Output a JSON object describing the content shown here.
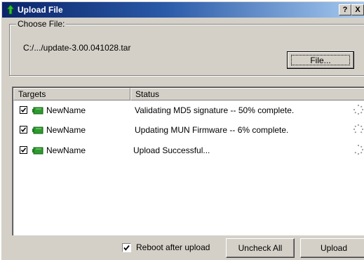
{
  "window": {
    "title": "Upload File",
    "help_label": "?",
    "close_label": "X"
  },
  "choose_file": {
    "legend": "Choose File:",
    "path": "C:/.../update-3.00.041028.tar",
    "file_button_label": "File..."
  },
  "list": {
    "columns": [
      "Targets",
      "Status"
    ],
    "rows": [
      {
        "checked": true,
        "target": "NewName",
        "status": "Validating MD5 signature -- 50% complete.",
        "icon": "device-icon",
        "progress_icon": "spinner-icon"
      },
      {
        "checked": true,
        "target": "NewName",
        "status": "Updating MUN Firmware -- 6% complete.",
        "icon": "device-icon",
        "progress_icon": "spinner-icon"
      },
      {
        "checked": true,
        "target": "NewName",
        "status": "Upload Successful...",
        "icon": "device-icon",
        "progress_icon": "spinner-icon"
      }
    ]
  },
  "footer": {
    "reboot_checked": true,
    "reboot_label": "Reboot after upload",
    "uncheck_all_label": "Uncheck All",
    "upload_label": "Upload"
  },
  "colors": {
    "titlebar_start": "#0a246a",
    "titlebar_end": "#a6caf0",
    "face": "#d4d0c8",
    "device_icon": "#2e9a2e"
  }
}
